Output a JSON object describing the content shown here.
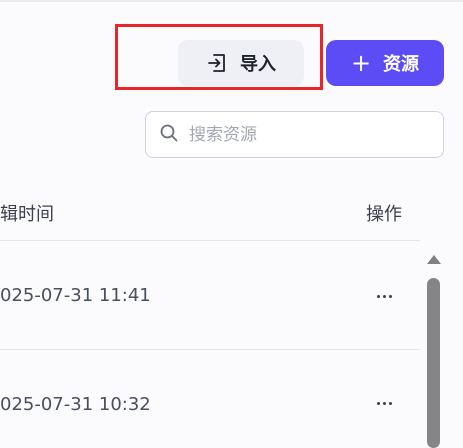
{
  "toolbar": {
    "import_label": "导入",
    "add_resource_label": "资源",
    "add_icon": "+"
  },
  "search": {
    "placeholder": "搜索资源",
    "value": ""
  },
  "table": {
    "columns": [
      "辑时间",
      "操作"
    ],
    "rows": [
      {
        "edited_time": "025-07-31 11:41",
        "actions_icon": "more-icon"
      },
      {
        "edited_time": "025-07-31 10:32",
        "actions_icon": "more-icon"
      }
    ]
  },
  "colors": {
    "primary": "#5b4cf5",
    "highlight": "#e8262a",
    "secondary_button_bg": "#eef0f5"
  }
}
